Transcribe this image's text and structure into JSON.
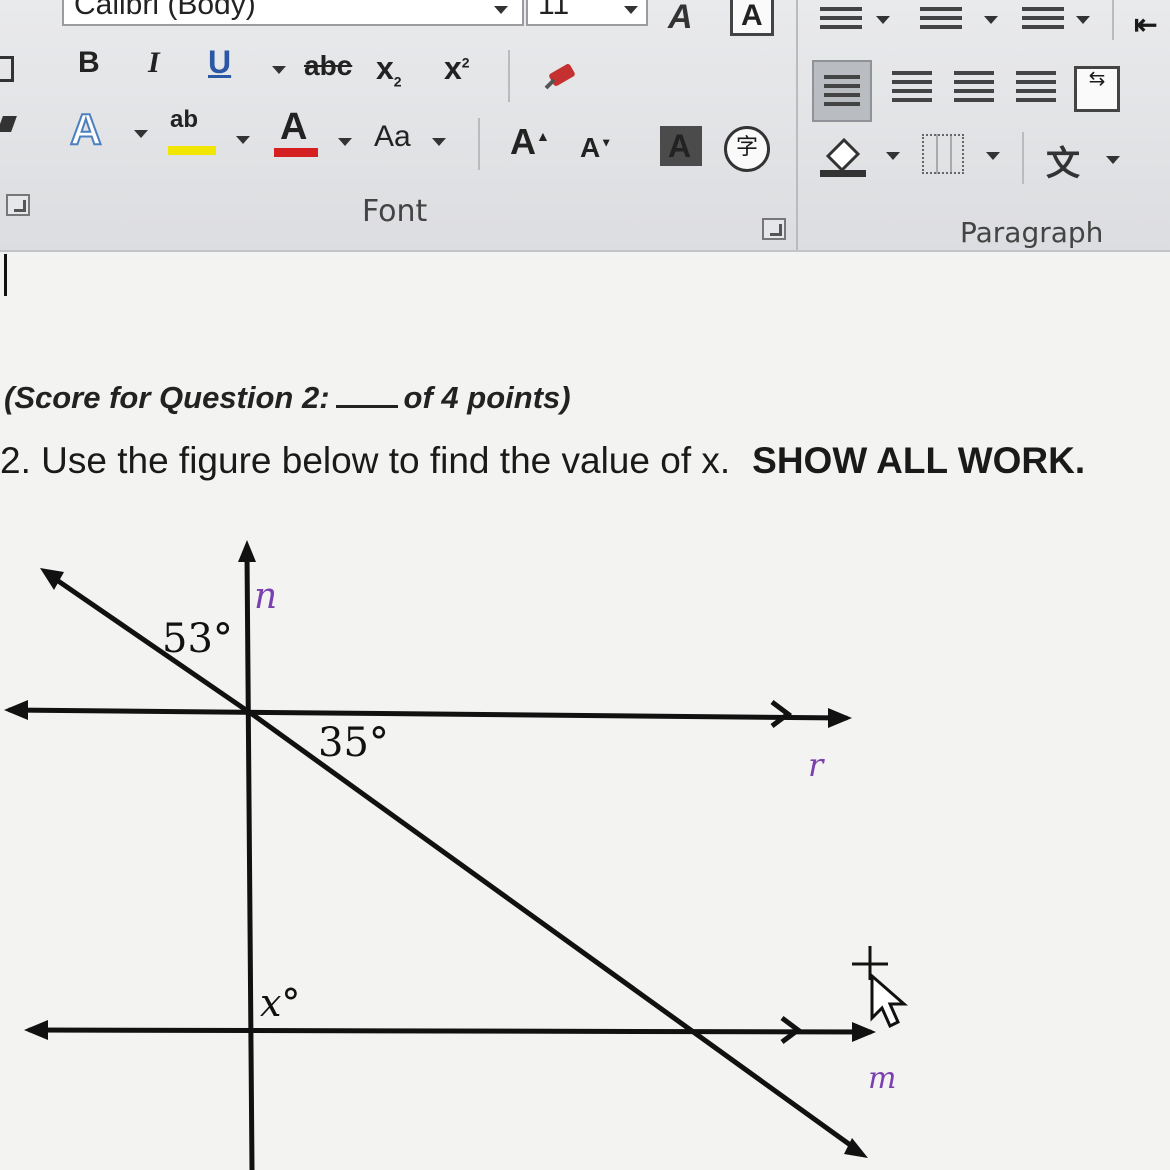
{
  "ribbon": {
    "font_name": "Calibri (Body)",
    "font_size": "11",
    "buttons": {
      "bold": "B",
      "italic": "I",
      "underline": "U",
      "strikethrough": "abc",
      "subscript": "x",
      "superscript": "x",
      "text_effects": "A",
      "highlight": "ab",
      "font_color": "A",
      "change_case": "Aa",
      "grow_font": "A",
      "shrink_font": "A",
      "char_shading": "A",
      "enclose": "字"
    },
    "groups": {
      "font_label": "Font",
      "paragraph_label": "Paragraph"
    },
    "colors": {
      "highlight_yellow": "#f2e600",
      "font_red": "#d42020",
      "effects_blue": "#4a7fc1"
    }
  },
  "document": {
    "score_prefix": "(Score for Question 2:",
    "score_suffix": "of 4 points)",
    "question_text": "2. Use the figure below to find the value of x.",
    "question_emphasis": "SHOW ALL WORK."
  },
  "figure": {
    "label_n": "n",
    "label_r": "r",
    "label_m": "m",
    "angle_53": "53°",
    "angle_35": "35°",
    "angle_x": "x°",
    "label_color": "#7a3fb0"
  }
}
